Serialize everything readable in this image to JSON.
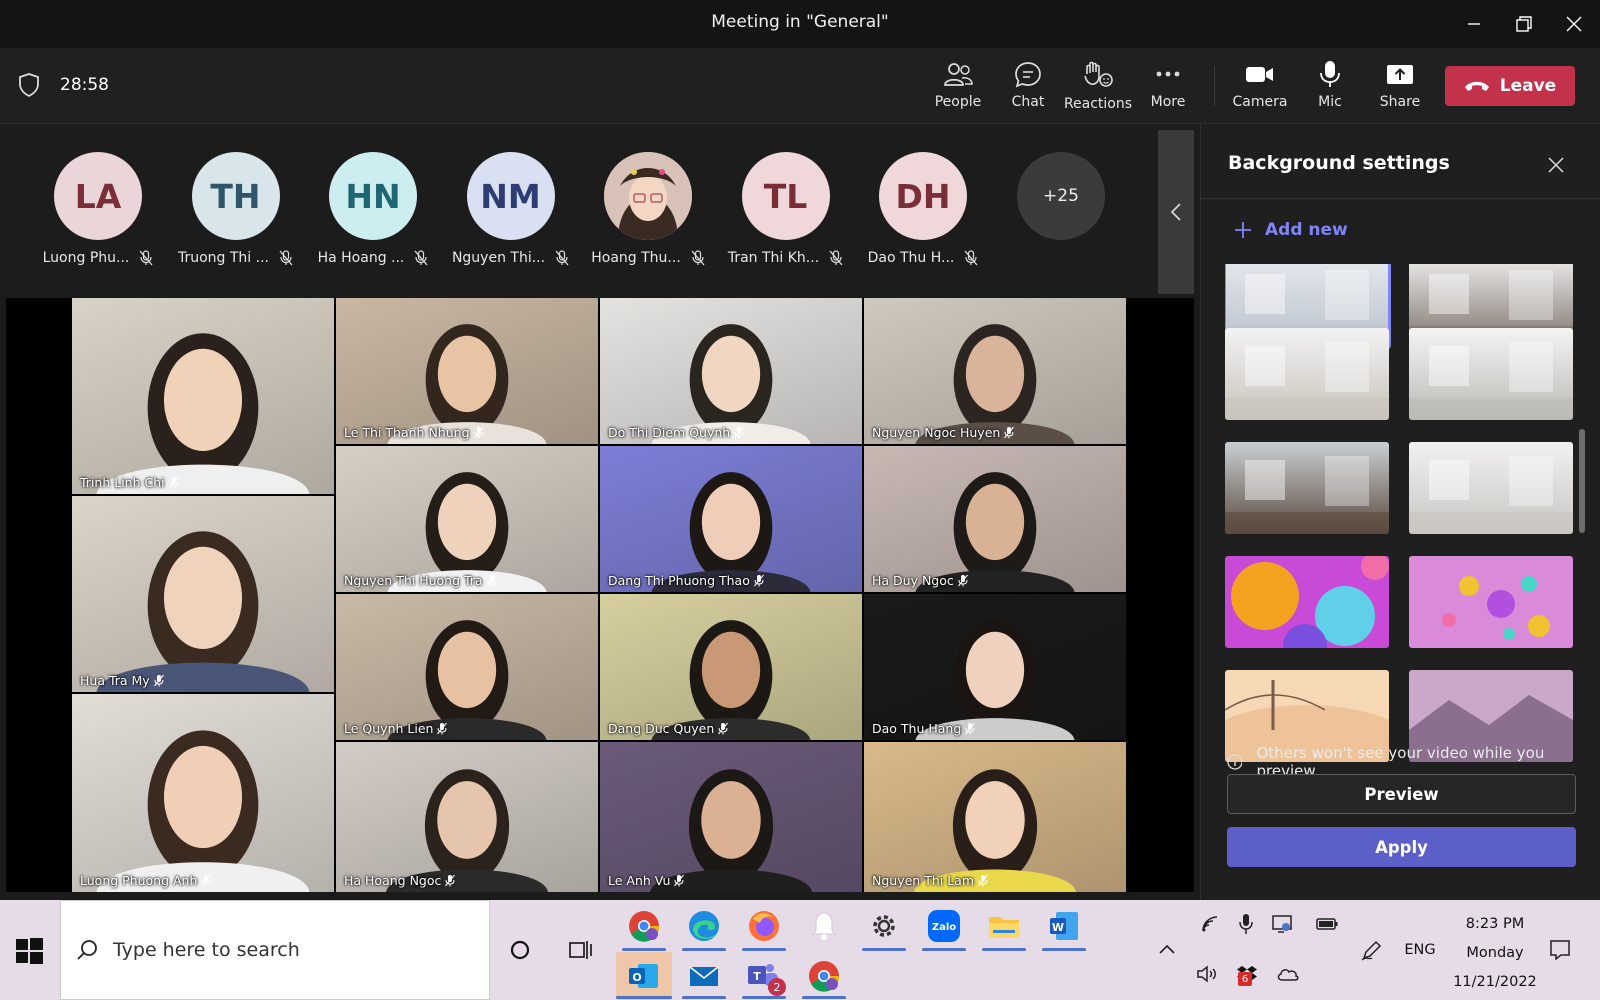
{
  "window": {
    "title": "Meeting in \"General\""
  },
  "toolbar": {
    "timer": "28:58",
    "people": "People",
    "chat": "Chat",
    "reactions": "Reactions",
    "more": "More",
    "camera": "Camera",
    "mic": "Mic",
    "share": "Share",
    "leave": "Leave"
  },
  "roster": [
    {
      "initials": "LA",
      "name": "Luong Phu...",
      "bg": "#ead6d8",
      "fg": "#7a2e37"
    },
    {
      "initials": "TH",
      "name": "Truong Thi ...",
      "bg": "#d8e6ec",
      "fg": "#2f5568"
    },
    {
      "initials": "HN",
      "name": "Ha Hoang ...",
      "bg": "#cdeef0",
      "fg": "#1f6770"
    },
    {
      "initials": "NM",
      "name": "Nguyen Thi...",
      "bg": "#d9e0f2",
      "fg": "#2d3d73"
    },
    {
      "initials": "",
      "name": "Hoang Thu...",
      "bg": "#d9c2b8",
      "fg": "#333333"
    },
    {
      "initials": "TL",
      "name": "Tran Thi Kh...",
      "bg": "#f0d8da",
      "fg": "#7a2e37"
    },
    {
      "initials": "DH",
      "name": "Dao Thu H...",
      "bg": "#f0d8da",
      "fg": "#7a2e37"
    }
  ],
  "roster_more": "+25",
  "tiles": [
    {
      "name": "Trinh Linh Chi",
      "bg": "#d9d2c6",
      "skin": "#f0d2b8",
      "hair": "#2a211c",
      "shirt": "#efefef"
    },
    {
      "name": "Le Thi Thanh Nhung",
      "bg": "#c9b7a3",
      "skin": "#e9c4a4",
      "hair": "#33261d",
      "shirt": "#e8e2da"
    },
    {
      "name": "Do Thi Diem Quynh",
      "bg": "#e5e3e0",
      "skin": "#f1d7c2",
      "hair": "#2b2520",
      "shirt": "#f0ece8"
    },
    {
      "name": "Nguyen Ngoc Huyen",
      "bg": "#cfc8bd",
      "skin": "#d9b49a",
      "hair": "#2b2420",
      "shirt": "#5a4e47"
    },
    {
      "name": "Hua Tra My",
      "bg": "#dcd4ca",
      "skin": "#f0d3bd",
      "hair": "#3a2b21",
      "shirt": "#4a5678"
    },
    {
      "name": "Nguyen Thi Huong Tra",
      "bg": "#d6cfc5",
      "skin": "#efd2bb",
      "hair": "#251d18",
      "shirt": "#f2f2f2"
    },
    {
      "name": "Dang Thi Phuong Thao",
      "bg": "#7c7ed6",
      "skin": "#efcdb8",
      "hair": "#1e1815",
      "shirt": "#2b2b3a"
    },
    {
      "name": "Ha Duy Ngoc",
      "bg": "#c7b8b2",
      "skin": "#d9b295",
      "hair": "#1e1a17",
      "shirt": "#222222"
    },
    {
      "name": "Le Quynh Lien",
      "bg": "#c9b9a6",
      "skin": "#e8c1a3",
      "hair": "#221a15",
      "shirt": "#2a2a2a"
    },
    {
      "name": "Dang Duc Quyen",
      "bg": "#d6cf9e",
      "skin": "#c99874",
      "hair": "#1c1814",
      "shirt": "#2c2c2c"
    },
    {
      "name": "Dao Thu Hang",
      "bg": "#1a1a1a",
      "skin": "#efd1bd",
      "hair": "#1a1512",
      "shirt": "#cccccc"
    },
    {
      "name": "Luong Phuong Anh",
      "bg": "#e2ddd6",
      "skin": "#f0cfb6",
      "hair": "#3a2a20",
      "shirt": "#f0f0f0"
    },
    {
      "name": "Ha Hoang Ngoc",
      "bg": "#d2ccc4",
      "skin": "#e5c6ad",
      "hair": "#2b221c",
      "shirt": "#2a2a2a"
    },
    {
      "name": "Le Anh Vu",
      "bg": "#6b5a7a",
      "skin": "#dcb193",
      "hair": "#1c1815",
      "shirt": "#1f1f1f"
    },
    {
      "name": "Nguyen Thi Lam",
      "bg": "#d9b98a",
      "skin": "#f1d2b9",
      "hair": "#2a1f18",
      "shirt": "#e8d84a"
    }
  ],
  "panel": {
    "title": "Background settings",
    "add_new": "Add new",
    "info": "Others won't see your video while you preview.",
    "preview": "Preview",
    "apply": "Apply"
  },
  "backgrounds": [
    {
      "name": "office-white",
      "colors": [
        "#e6e9ee",
        "#b8c0cc"
      ]
    },
    {
      "name": "office-shelves",
      "colors": [
        "#ededed",
        "#7b7066"
      ]
    },
    {
      "name": "white-loft-stairs",
      "colors": [
        "#f2f2f2",
        "#c9c4bc"
      ]
    },
    {
      "name": "white-empty-room",
      "colors": [
        "#f4f4f4",
        "#bdbab5"
      ]
    },
    {
      "name": "glass-office",
      "colors": [
        "#c9cfd4",
        "#5b4a3e"
      ]
    },
    {
      "name": "white-wall-room",
      "colors": [
        "#f1f1f1",
        "#c9c6c1"
      ]
    },
    {
      "name": "colorful-spheres",
      "colors": [
        "#f4a21f",
        "#c94ad6"
      ]
    },
    {
      "name": "pink-bubbles",
      "colors": [
        "#e58ad6",
        "#a64ee0"
      ]
    },
    {
      "name": "bridge-sunset",
      "colors": [
        "#f6d9b4",
        "#f0b98f"
      ]
    },
    {
      "name": "purple-mountains",
      "colors": [
        "#c9a8c8",
        "#8a6f8f"
      ]
    }
  ],
  "taskbar": {
    "search_placeholder": "Type here to search",
    "language": "ENG",
    "time": "8:23 PM",
    "day": "Monday",
    "date": "11/21/2022",
    "teams_badge": "2",
    "dropbox_badge": "6"
  }
}
